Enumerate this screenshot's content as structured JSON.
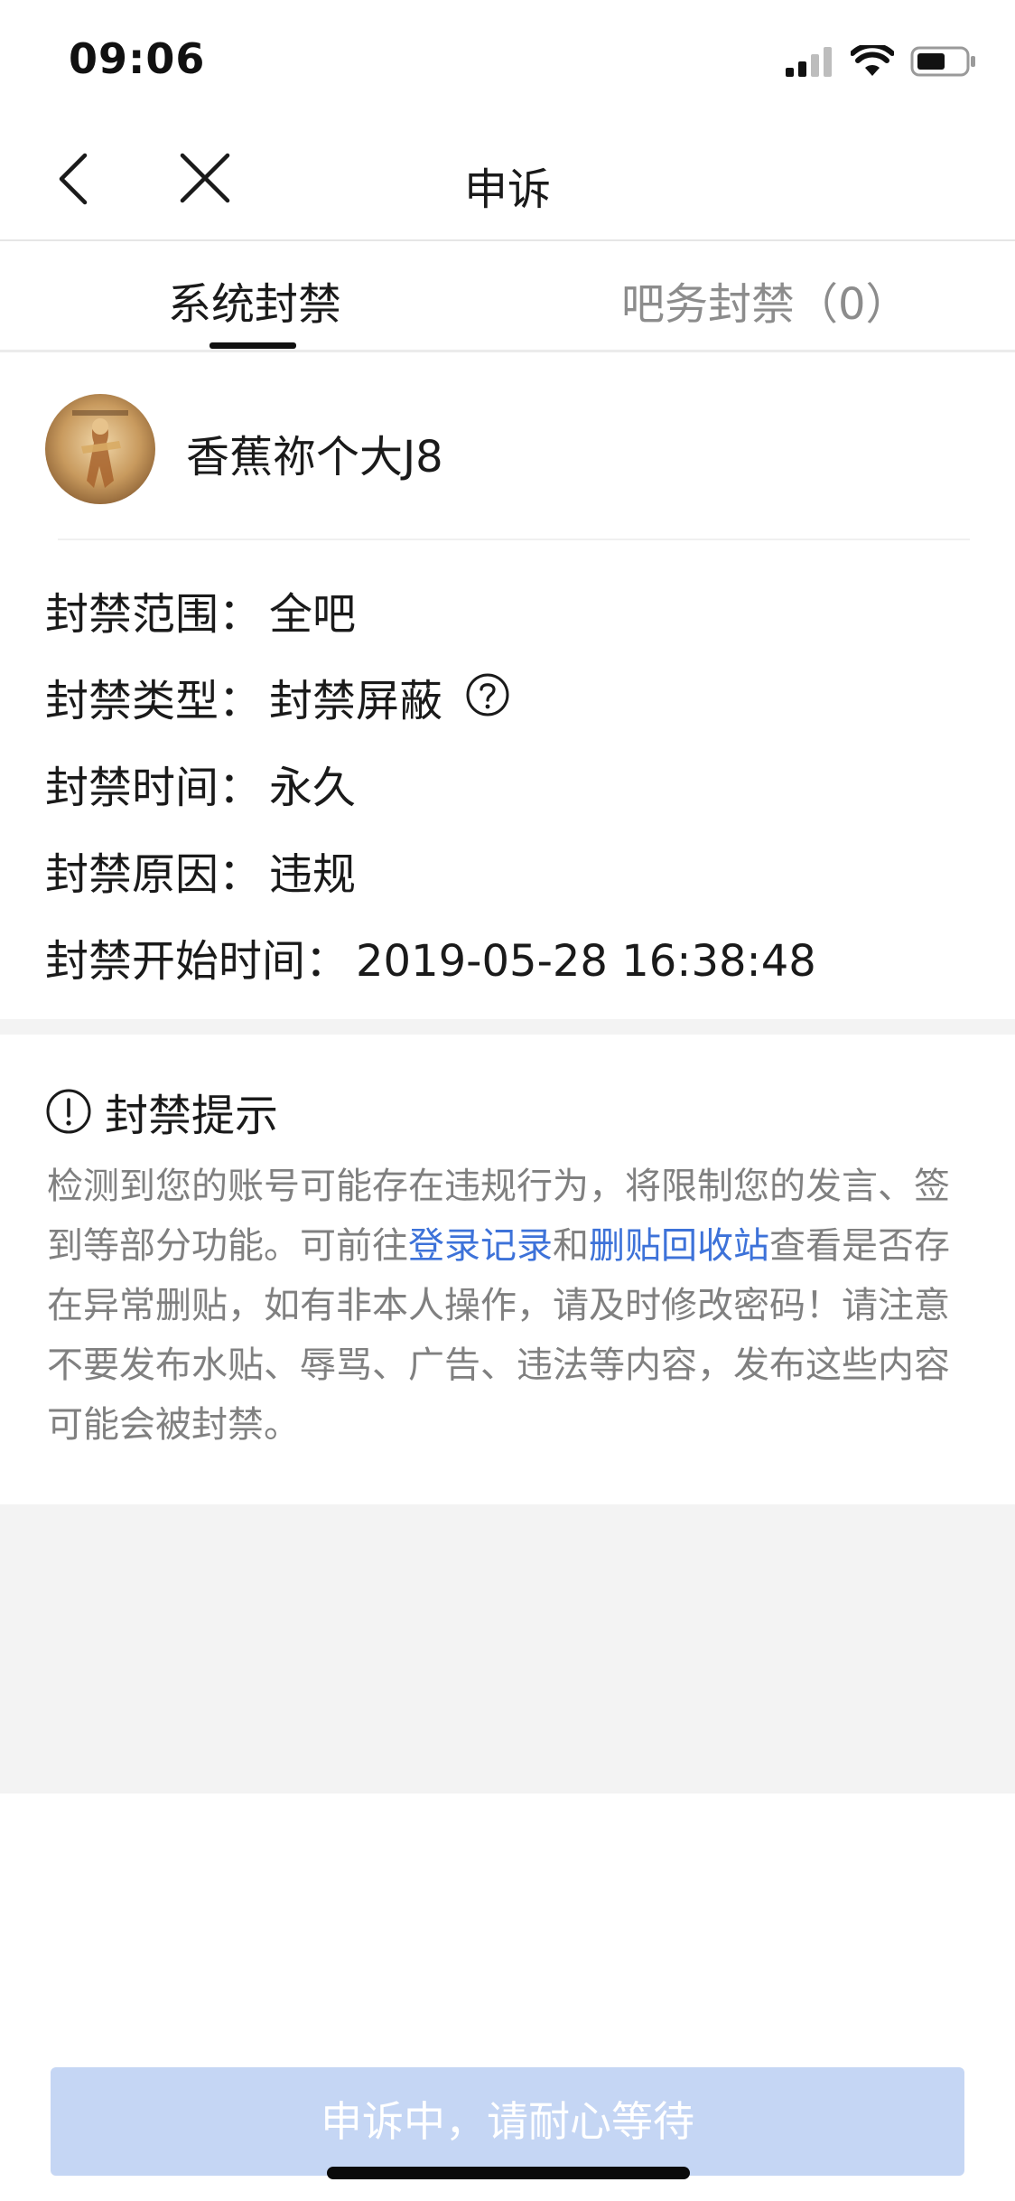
{
  "status_bar": {
    "time": "09:06"
  },
  "nav": {
    "title": "申诉"
  },
  "tabs": [
    {
      "label": "系统封禁"
    },
    {
      "label": "吧务封禁（0）"
    }
  ],
  "profile": {
    "username": "香蕉祢个大J8"
  },
  "ban_info": {
    "scope_label": "封禁范围：",
    "scope_value": "全吧",
    "type_label": "封禁类型：",
    "type_value": "封禁屏蔽",
    "time_label": "封禁时间：",
    "time_value": "永久",
    "reason_label": "封禁原因：",
    "reason_value": "违规",
    "start_label": "封禁开始时间：",
    "start_value": "2019-05-28 16:38:48"
  },
  "notice": {
    "title": "封禁提示",
    "text_1": "检测到您的账号可能存在违规行为，将限制您的发言、签到等部分功能。可前往",
    "link_login": "登录记录",
    "text_2": "和",
    "link_recycle": "删贴回收站",
    "text_3": "查看是否存在异常删贴，如有非本人操作，请及时修改密码！请注意不要发布水贴、辱骂、广告、违法等内容，发布这些内容可能会被封禁。"
  },
  "footer": {
    "button_label": "申诉中，请耐心等待"
  },
  "colors": {
    "link": "#3d72d9",
    "button_disabled": "#c5d6f4",
    "muted_text": "#808080"
  }
}
